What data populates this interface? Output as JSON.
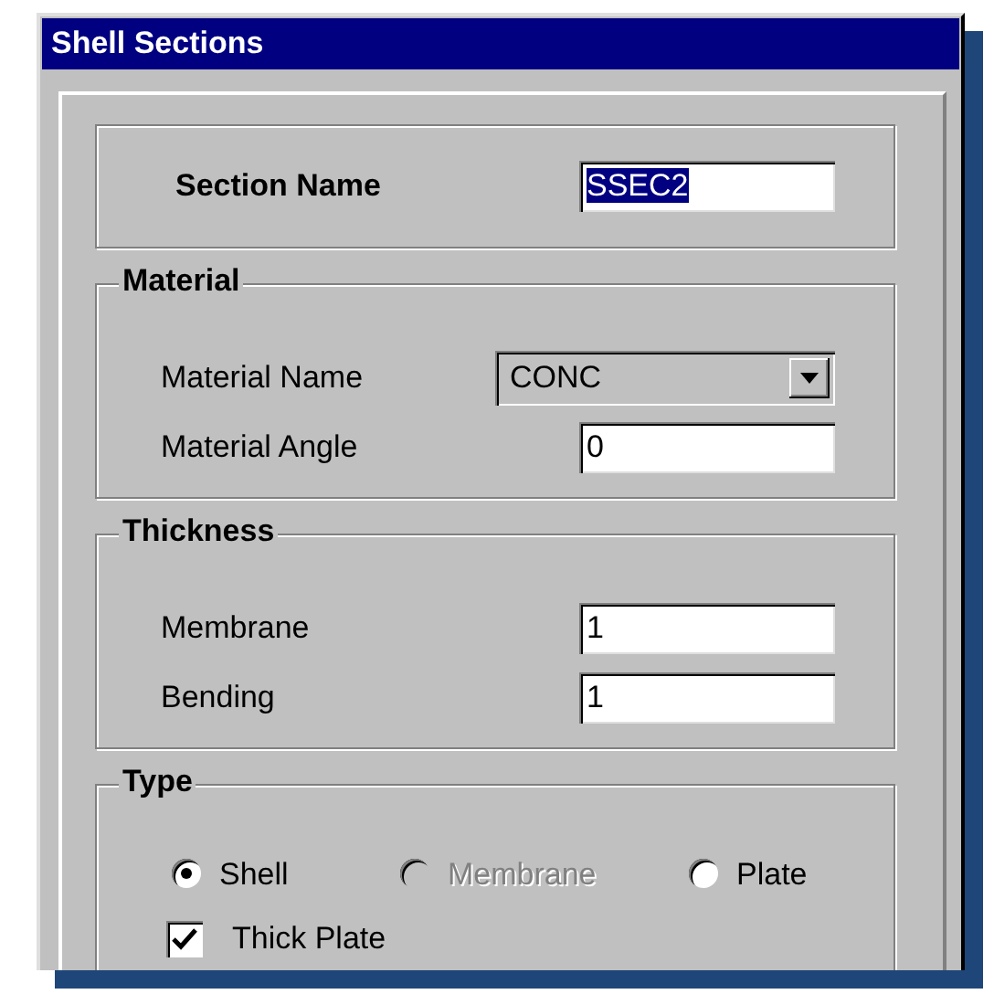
{
  "window": {
    "title": "Shell Sections"
  },
  "section_name": {
    "label": "Section Name",
    "value": "SSEC2",
    "selected": true
  },
  "material": {
    "title": "Material",
    "fields": [
      {
        "kind": "dropdown",
        "label": "Material Name",
        "value": "CONC"
      },
      {
        "kind": "text",
        "label": "Material Angle",
        "value": "0"
      }
    ]
  },
  "thickness": {
    "title": "Thickness",
    "fields": [
      {
        "kind": "text",
        "label": "Membrane",
        "value": "1"
      },
      {
        "kind": "text",
        "label": "Bending",
        "value": "1"
      }
    ]
  },
  "type": {
    "title": "Type",
    "options": [
      {
        "label": "Shell",
        "selected": true,
        "disabled": false
      },
      {
        "label": "Membrane",
        "selected": false,
        "disabled": true
      },
      {
        "label": "Plate",
        "selected": false,
        "disabled": false
      }
    ],
    "thick_plate": {
      "label": "Thick Plate",
      "checked": true
    }
  }
}
